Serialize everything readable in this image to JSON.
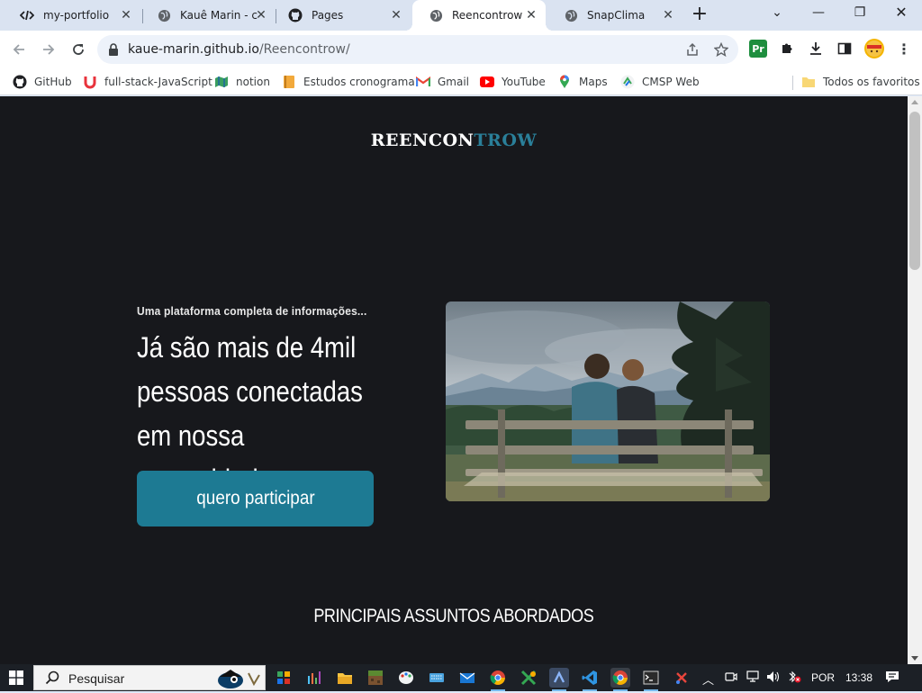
{
  "browser": {
    "tabs": [
      {
        "title": "my-portfolio",
        "icon": "code-icon",
        "active": false
      },
      {
        "title": "Kauê Marin - c…",
        "icon": "globe-icon",
        "active": false
      },
      {
        "title": "Pages",
        "icon": "github-icon",
        "active": false
      },
      {
        "title": "Reencontrow",
        "icon": "globe-icon",
        "active": true
      },
      {
        "title": "SnapClima",
        "icon": "globe-icon",
        "active": false
      }
    ],
    "new_tab_glyph": "+",
    "url_host": "kaue-marin.github.io",
    "url_path": "/Reencontrow/",
    "extensions": [
      {
        "name": "Pr",
        "color": "#1e8e3e"
      }
    ],
    "bookmarks": [
      {
        "label": "GitHub",
        "icon": "github-icon"
      },
      {
        "label": "full-stack-JavaScript",
        "icon": "magnet-icon"
      },
      {
        "label": "notion",
        "icon": "map-icon"
      },
      {
        "label": "Estudos cronograma",
        "icon": "notebook-icon"
      },
      {
        "label": "Gmail",
        "icon": "gmail-icon"
      },
      {
        "label": "YouTube",
        "icon": "youtube-icon"
      },
      {
        "label": "Maps",
        "icon": "maps-pin-icon"
      },
      {
        "label": "CMSP Web",
        "icon": "cmsp-icon"
      }
    ],
    "all_bookmarks_label": "Todos os favoritos"
  },
  "page": {
    "logo_part1": "REENCON",
    "logo_part2": "TROW",
    "eyebrow": "Uma plataforma completa de informações...",
    "headline_line1": "Já são mais de 4mil",
    "headline_line2": "pessoas conectadas",
    "headline_line3": "em nossa comunidade",
    "cta_label": "quero participar",
    "section_title": "PRINCIPAIS ASSUNTOS ABORDADOS"
  },
  "taskbar": {
    "search_placeholder": "Pesquisar",
    "language": "POR",
    "time": "13:38"
  },
  "colors": {
    "page_bg": "#17181c",
    "accent": "#1d7a93",
    "logo_accent": "#2a7f99"
  }
}
